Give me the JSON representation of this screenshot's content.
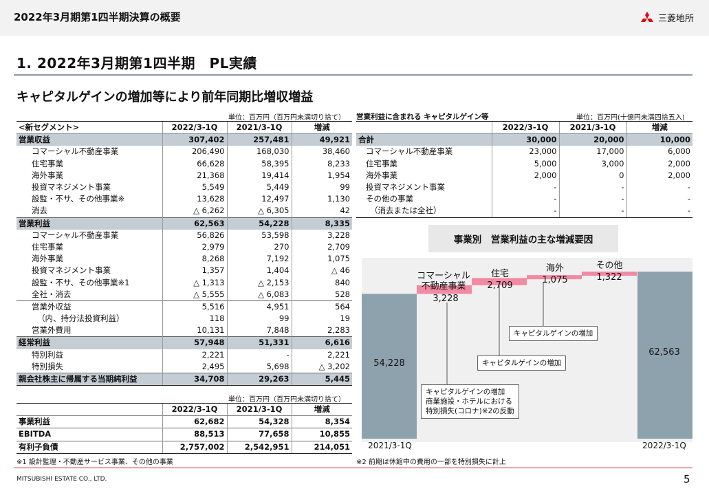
{
  "header": {
    "title": "2022年3月期第1四半期決算の概要",
    "logo": "三菱地所"
  },
  "section_title": "1. 2022年3月期第1四半期　PL実績",
  "subtitle": "キャピタルゲインの増加等により前年同期比増収増益",
  "left_table": {
    "unit": "単位：百万円（百万円未満切り捨て）",
    "headers": [
      "<新セグメント>",
      "2022/3-1Q",
      "2021/3-1Q",
      "増減"
    ],
    "rows": [
      {
        "label": "営業収益",
        "v1": "307,402",
        "v2": "257,481",
        "v3": "49,921"
      },
      {
        "label": "コマーシャル不動産事業",
        "v1": "206,490",
        "v2": "168,030",
        "v3": "38,460"
      },
      {
        "label": "住宅事業",
        "v1": "66,628",
        "v2": "58,395",
        "v3": "8,233"
      },
      {
        "label": "海外事業",
        "v1": "21,368",
        "v2": "19,414",
        "v3": "1,954"
      },
      {
        "label": "投資マネジメント事業",
        "v1": "5,549",
        "v2": "5,449",
        "v3": "99"
      },
      {
        "label": "設監・不サ、その他事業※",
        "v1": "13,628",
        "v2": "12,497",
        "v3": "1,130"
      },
      {
        "label": "消去",
        "v1": "△ 6,262",
        "v2": "△ 6,305",
        "v3": "42"
      },
      {
        "label": "営業利益",
        "v1": "62,563",
        "v2": "54,228",
        "v3": "8,335"
      },
      {
        "label": "コマーシャル不動産事業",
        "v1": "56,826",
        "v2": "53,598",
        "v3": "3,228"
      },
      {
        "label": "住宅事業",
        "v1": "2,979",
        "v2": "270",
        "v3": "2,709"
      },
      {
        "label": "海外事業",
        "v1": "8,268",
        "v2": "7,192",
        "v3": "1,075"
      },
      {
        "label": "投資マネジメント事業",
        "v1": "1,357",
        "v2": "1,404",
        "v3": "△ 46"
      },
      {
        "label": "設監・不サ、その他事業※1",
        "v1": "△ 1,313",
        "v2": "△ 2,153",
        "v3": "840"
      },
      {
        "label": "全社・消去",
        "v1": "△ 5,555",
        "v2": "△ 6,083",
        "v3": "528"
      },
      {
        "label": "営業外収益",
        "v1": "5,516",
        "v2": "4,951",
        "v3": "564"
      },
      {
        "label": "（内、持分法投資利益）",
        "v1": "118",
        "v2": "99",
        "v3": "19"
      },
      {
        "label": "営業外費用",
        "v1": "10,131",
        "v2": "7,848",
        "v3": "2,283"
      },
      {
        "label": "経常利益",
        "v1": "57,948",
        "v2": "51,331",
        "v3": "6,616"
      },
      {
        "label": "特別利益",
        "v1": "2,221",
        "v2": "-",
        "v3": "2,221"
      },
      {
        "label": "特別損失",
        "v1": "2,495",
        "v2": "5,698",
        "v3": "△ 3,202"
      },
      {
        "label": "親会社株主に帰属する当期純利益",
        "v1": "34,708",
        "v2": "29,263",
        "v3": "5,445"
      }
    ]
  },
  "lower_table": {
    "unit": "単位：百万円（百万円未満切り捨て）",
    "headers": [
      "",
      "2022/3-1Q",
      "2021/3-1Q",
      "増減"
    ],
    "rows": [
      {
        "label": "事業利益",
        "v1": "62,682",
        "v2": "54,328",
        "v3": "8,354"
      },
      {
        "label": "EBITDA",
        "v1": "88,513",
        "v2": "77,658",
        "v3": "10,855"
      },
      {
        "label": "有利子負債",
        "v1": "2,757,002",
        "v2": "2,542,951",
        "v3": "214,051"
      }
    ]
  },
  "right_table": {
    "title": "営業利益に含まれる キャピタルゲイン等",
    "unit": "単位：百万円(十億円未満四捨五入)",
    "headers": [
      "",
      "2022/3-1Q",
      "2021/3-1Q",
      "増減"
    ],
    "rows": [
      {
        "label": "合計",
        "v1": "30,000",
        "v2": "20,000",
        "v3": "10,000"
      },
      {
        "label": "コマーシャル不動産事業",
        "v1": "23,000",
        "v2": "17,000",
        "v3": "6,000"
      },
      {
        "label": "住宅事業",
        "v1": "5,000",
        "v2": "3,000",
        "v3": "2,000"
      },
      {
        "label": "海外事業",
        "v1": "2,000",
        "v2": "0",
        "v3": "2,000"
      },
      {
        "label": "投資マネジメント事業",
        "v1": "-",
        "v2": "-",
        "v3": "-"
      },
      {
        "label": "その他の事業",
        "v1": "-",
        "v2": "-",
        "v3": "-"
      },
      {
        "label": "（消去または全社）",
        "v1": "-",
        "v2": "-",
        "v3": "-"
      }
    ]
  },
  "chart_data": {
    "type": "bar",
    "title": "事業別　営業利益の主な増減要因",
    "categories": [
      "2021/3-1Q",
      "コマーシャル不動産事業",
      "住宅",
      "海外",
      "その他",
      "2022/3-1Q"
    ],
    "values": [
      54228,
      3228,
      2709,
      1075,
      1322,
      62563
    ],
    "bar_labels": [
      "54,228",
      "3,228",
      "2,709",
      "1,075",
      "1,322",
      "62,563"
    ],
    "colors": {
      "total": "#8ea2ad",
      "increase": "#f28aa3"
    }
  },
  "callouts": [
    "キャピタルゲインの増加\n商業施設・ホテルにおける\n特別損失(コロナ)※2の反動",
    "キャピタルゲインの増加",
    "キャピタルゲインの増加"
  ],
  "footnotes": {
    "left": "※1 設計監理・不動産サービス事業、その他の事業",
    "right": "※2 前期は休館中の費用の一部を特別損失に計上"
  },
  "footer": {
    "company": "MITSUBISHI ESTATE CO., LTD.",
    "page": "5"
  }
}
